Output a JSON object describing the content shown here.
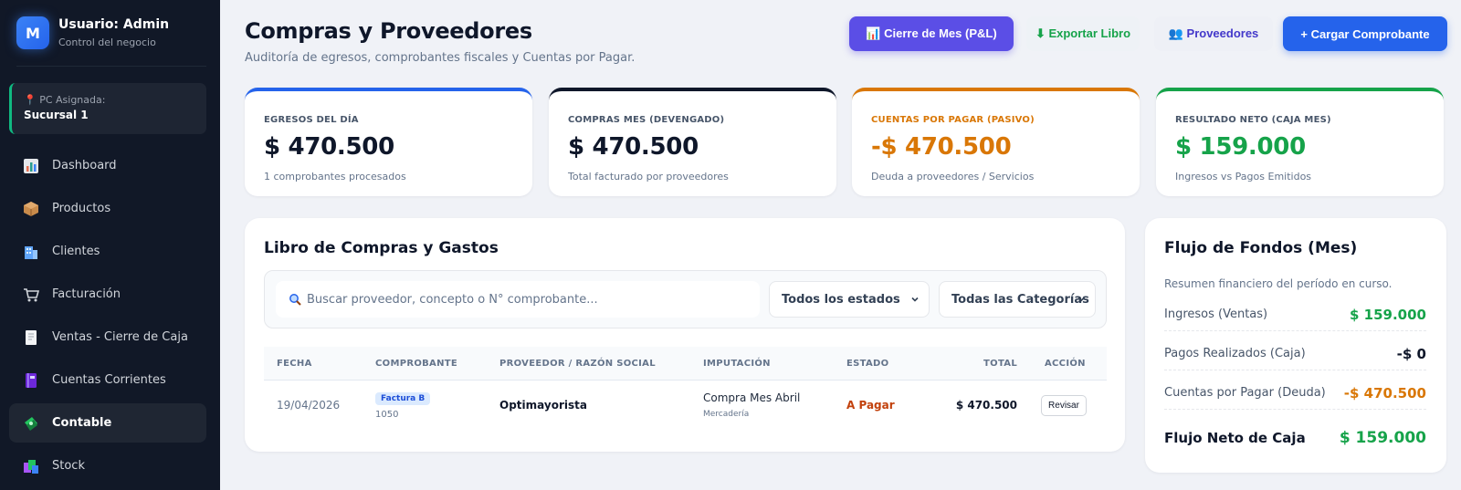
{
  "sidebar": {
    "avatar_letter": "M",
    "user_name": "Usuario: Admin",
    "user_sub": "Control del negocio",
    "pc_label": "📍 PC Asignada:",
    "pc_value": "Sucursal 1",
    "items": [
      {
        "label": "Dashboard",
        "icon": "bar-chart-icon",
        "color": "#e76f51",
        "active": false
      },
      {
        "label": "Productos",
        "icon": "box-icon",
        "color": "#c98b4b",
        "active": false
      },
      {
        "label": "Clientes",
        "icon": "building-icon",
        "color": "#60a5fa",
        "active": false
      },
      {
        "label": "Facturación",
        "icon": "cart-icon",
        "color": "#9ca3af",
        "active": false
      },
      {
        "label": "Ventas - Cierre de Caja",
        "icon": "receipt-icon",
        "color": "#e5e7eb",
        "active": false
      },
      {
        "label": "Cuentas Corrientes",
        "icon": "notebook-icon",
        "color": "#7c3aed",
        "active": false
      },
      {
        "label": "Contable",
        "icon": "money-icon",
        "color": "#22c55e",
        "active": true
      },
      {
        "label": "Stock",
        "icon": "stock-icon",
        "color": "#a855f7",
        "active": false
      }
    ]
  },
  "header": {
    "title": "Compras y Proveedores",
    "subtitle": "Auditoría de egresos, comprobantes fiscales y Cuentas por Pagar.",
    "btn_pl": "📊 Cierre de Mes (P&L)",
    "btn_export": "⬇ Exportar Libro",
    "btn_prov": "👥 Proveedores",
    "btn_load": "+ Cargar Comprobante"
  },
  "cards": [
    {
      "label": "EGRESOS DEL DÍA",
      "value": "$ 470.500",
      "sub": "1 comprobantes procesados"
    },
    {
      "label": "COMPRAS MES (DEVENGADO)",
      "value": "$ 470.500",
      "sub": "Total facturado por proveedores"
    },
    {
      "label": "CUENTAS POR PAGAR (PASIVO)",
      "value": "-$ 470.500",
      "sub": "Deuda a proveedores / Servicios"
    },
    {
      "label": "RESULTADO NETO (CAJA MES)",
      "value": "$ 159.000",
      "sub": "Ingresos vs Pagos Emitidos"
    }
  ],
  "book": {
    "title": "Libro de Compras y Gastos",
    "search_placeholder": "Buscar proveedor, concepto o N° comprobante...",
    "filter_estado": "Todos los estados",
    "filter_categoria": "Todas las Categorías",
    "columns": [
      "FECHA",
      "COMPROBANTE",
      "PROVEEDOR / RAZÓN SOCIAL",
      "IMPUTACIÓN",
      "ESTADO",
      "TOTAL",
      "ACCIÓN"
    ],
    "rows": [
      {
        "fecha": "19/04/2026",
        "tipo": "Factura B",
        "numero": "1050",
        "proveedor": "Optimayorista",
        "imputacion": "Compra Mes Abril",
        "categoria": "Mercadería",
        "estado": "A Pagar",
        "total": "$ 470.500",
        "accion": "Revisar"
      }
    ]
  },
  "flow": {
    "title": "Flujo de Fondos (Mes)",
    "subtitle": "Resumen financiero del período en curso.",
    "rows": [
      {
        "label": "Ingresos (Ventas)",
        "value": "$ 159.000"
      },
      {
        "label": "Pagos Realizados (Caja)",
        "value": "-$ 0"
      },
      {
        "label": "Cuentas por Pagar (Deuda)",
        "value": "-$ 470.500"
      }
    ],
    "net_label": "Flujo Neto de Caja",
    "net_value": "$ 159.000"
  },
  "colors": {
    "green": "#16a34a",
    "orange": "#d97706",
    "blue": "#2563eb",
    "purple": "#5b4ee6"
  }
}
